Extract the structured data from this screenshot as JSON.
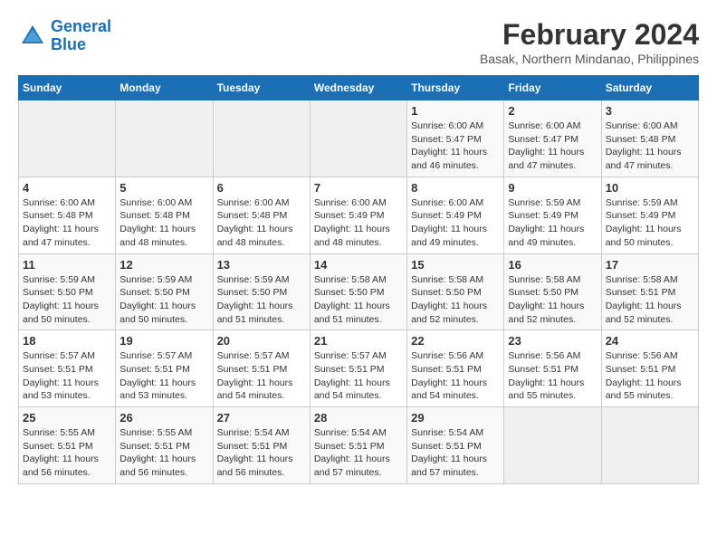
{
  "header": {
    "logo_line1": "General",
    "logo_line2": "Blue",
    "title": "February 2024",
    "subtitle": "Basak, Northern Mindanao, Philippines"
  },
  "weekdays": [
    "Sunday",
    "Monday",
    "Tuesday",
    "Wednesday",
    "Thursday",
    "Friday",
    "Saturday"
  ],
  "weeks": [
    [
      {
        "day": "",
        "info": ""
      },
      {
        "day": "",
        "info": ""
      },
      {
        "day": "",
        "info": ""
      },
      {
        "day": "",
        "info": ""
      },
      {
        "day": "1",
        "info": "Sunrise: 6:00 AM\nSunset: 5:47 PM\nDaylight: 11 hours\nand 46 minutes."
      },
      {
        "day": "2",
        "info": "Sunrise: 6:00 AM\nSunset: 5:47 PM\nDaylight: 11 hours\nand 47 minutes."
      },
      {
        "day": "3",
        "info": "Sunrise: 6:00 AM\nSunset: 5:48 PM\nDaylight: 11 hours\nand 47 minutes."
      }
    ],
    [
      {
        "day": "4",
        "info": "Sunrise: 6:00 AM\nSunset: 5:48 PM\nDaylight: 11 hours\nand 47 minutes."
      },
      {
        "day": "5",
        "info": "Sunrise: 6:00 AM\nSunset: 5:48 PM\nDaylight: 11 hours\nand 48 minutes."
      },
      {
        "day": "6",
        "info": "Sunrise: 6:00 AM\nSunset: 5:48 PM\nDaylight: 11 hours\nand 48 minutes."
      },
      {
        "day": "7",
        "info": "Sunrise: 6:00 AM\nSunset: 5:49 PM\nDaylight: 11 hours\nand 48 minutes."
      },
      {
        "day": "8",
        "info": "Sunrise: 6:00 AM\nSunset: 5:49 PM\nDaylight: 11 hours\nand 49 minutes."
      },
      {
        "day": "9",
        "info": "Sunrise: 5:59 AM\nSunset: 5:49 PM\nDaylight: 11 hours\nand 49 minutes."
      },
      {
        "day": "10",
        "info": "Sunrise: 5:59 AM\nSunset: 5:49 PM\nDaylight: 11 hours\nand 50 minutes."
      }
    ],
    [
      {
        "day": "11",
        "info": "Sunrise: 5:59 AM\nSunset: 5:50 PM\nDaylight: 11 hours\nand 50 minutes."
      },
      {
        "day": "12",
        "info": "Sunrise: 5:59 AM\nSunset: 5:50 PM\nDaylight: 11 hours\nand 50 minutes."
      },
      {
        "day": "13",
        "info": "Sunrise: 5:59 AM\nSunset: 5:50 PM\nDaylight: 11 hours\nand 51 minutes."
      },
      {
        "day": "14",
        "info": "Sunrise: 5:58 AM\nSunset: 5:50 PM\nDaylight: 11 hours\nand 51 minutes."
      },
      {
        "day": "15",
        "info": "Sunrise: 5:58 AM\nSunset: 5:50 PM\nDaylight: 11 hours\nand 52 minutes."
      },
      {
        "day": "16",
        "info": "Sunrise: 5:58 AM\nSunset: 5:50 PM\nDaylight: 11 hours\nand 52 minutes."
      },
      {
        "day": "17",
        "info": "Sunrise: 5:58 AM\nSunset: 5:51 PM\nDaylight: 11 hours\nand 52 minutes."
      }
    ],
    [
      {
        "day": "18",
        "info": "Sunrise: 5:57 AM\nSunset: 5:51 PM\nDaylight: 11 hours\nand 53 minutes."
      },
      {
        "day": "19",
        "info": "Sunrise: 5:57 AM\nSunset: 5:51 PM\nDaylight: 11 hours\nand 53 minutes."
      },
      {
        "day": "20",
        "info": "Sunrise: 5:57 AM\nSunset: 5:51 PM\nDaylight: 11 hours\nand 54 minutes."
      },
      {
        "day": "21",
        "info": "Sunrise: 5:57 AM\nSunset: 5:51 PM\nDaylight: 11 hours\nand 54 minutes."
      },
      {
        "day": "22",
        "info": "Sunrise: 5:56 AM\nSunset: 5:51 PM\nDaylight: 11 hours\nand 54 minutes."
      },
      {
        "day": "23",
        "info": "Sunrise: 5:56 AM\nSunset: 5:51 PM\nDaylight: 11 hours\nand 55 minutes."
      },
      {
        "day": "24",
        "info": "Sunrise: 5:56 AM\nSunset: 5:51 PM\nDaylight: 11 hours\nand 55 minutes."
      }
    ],
    [
      {
        "day": "25",
        "info": "Sunrise: 5:55 AM\nSunset: 5:51 PM\nDaylight: 11 hours\nand 56 minutes."
      },
      {
        "day": "26",
        "info": "Sunrise: 5:55 AM\nSunset: 5:51 PM\nDaylight: 11 hours\nand 56 minutes."
      },
      {
        "day": "27",
        "info": "Sunrise: 5:54 AM\nSunset: 5:51 PM\nDaylight: 11 hours\nand 56 minutes."
      },
      {
        "day": "28",
        "info": "Sunrise: 5:54 AM\nSunset: 5:51 PM\nDaylight: 11 hours\nand 57 minutes."
      },
      {
        "day": "29",
        "info": "Sunrise: 5:54 AM\nSunset: 5:51 PM\nDaylight: 11 hours\nand 57 minutes."
      },
      {
        "day": "",
        "info": ""
      },
      {
        "day": "",
        "info": ""
      }
    ]
  ]
}
